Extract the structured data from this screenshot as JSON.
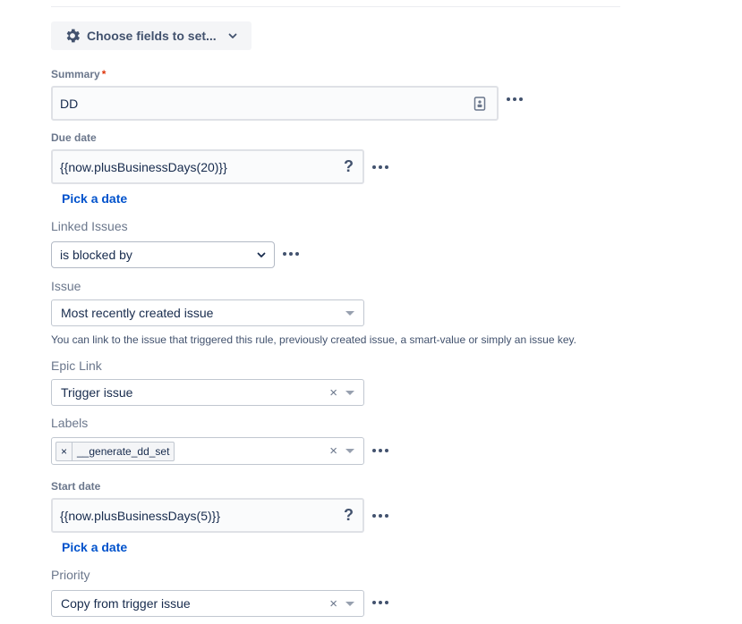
{
  "choose_fields": {
    "label": "Choose fields to set...",
    "icon": "gear-icon"
  },
  "summary": {
    "label": "Summary",
    "required_mark": "*",
    "value": "DD"
  },
  "due_date": {
    "label": "Due date",
    "value": "{{now.plusBusinessDays(20)}}",
    "help_symbol": "?",
    "pick_label": "Pick a date"
  },
  "linked_issues": {
    "label": "Linked Issues",
    "selected": "is blocked by",
    "issue_label": "Issue",
    "issue_selected": "Most recently created issue",
    "help_text": "You can link to the issue that triggered this rule, previously created issue, a smart-value or simply an issue key."
  },
  "epic_link": {
    "label": "Epic Link",
    "selected": "Trigger issue",
    "clear_symbol": "×"
  },
  "labels": {
    "label": "Labels",
    "tags": [
      "__generate_dd_set"
    ],
    "tag_remove_symbol": "×",
    "clear_symbol": "×"
  },
  "start_date": {
    "label": "Start date",
    "value": "{{now.plusBusinessDays(5)}}",
    "help_symbol": "?",
    "pick_label": "Pick a date"
  },
  "priority": {
    "label": "Priority",
    "selected": "Copy from trigger issue",
    "clear_symbol": "×"
  },
  "colors": {
    "link": "#0052cc",
    "required": "#de350b",
    "label": "#6b778c",
    "field_bg": "#fafbfc"
  }
}
